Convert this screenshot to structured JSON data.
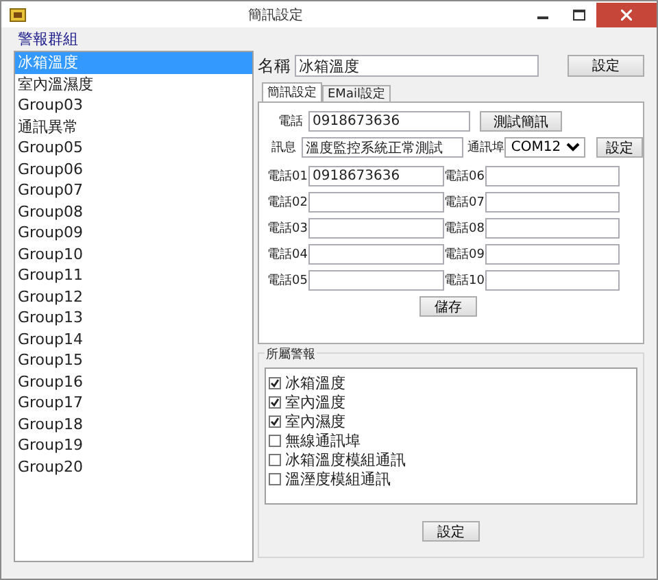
{
  "window": {
    "title": "簡訊設定"
  },
  "groups": {
    "label": "警報群組",
    "items": [
      {
        "text": "冰箱溫度",
        "selected": true
      },
      {
        "text": "室內溫濕度",
        "selected": false
      },
      {
        "text": "Group03",
        "selected": false
      },
      {
        "text": "通訊異常",
        "selected": false
      },
      {
        "text": "Group05",
        "selected": false
      },
      {
        "text": "Group06",
        "selected": false
      },
      {
        "text": "Group07",
        "selected": false
      },
      {
        "text": "Group08",
        "selected": false
      },
      {
        "text": "Group09",
        "selected": false
      },
      {
        "text": "Group10",
        "selected": false
      },
      {
        "text": "Group11",
        "selected": false
      },
      {
        "text": "Group12",
        "selected": false
      },
      {
        "text": "Group13",
        "selected": false
      },
      {
        "text": "Group14",
        "selected": false
      },
      {
        "text": "Group15",
        "selected": false
      },
      {
        "text": "Group16",
        "selected": false
      },
      {
        "text": "Group17",
        "selected": false
      },
      {
        "text": "Group18",
        "selected": false
      },
      {
        "text": "Group19",
        "selected": false
      },
      {
        "text": "Group20",
        "selected": false
      }
    ]
  },
  "name": {
    "label": "名稱",
    "value": "冰箱溫度",
    "button": "設定"
  },
  "tabs": [
    {
      "label": "簡訊設定",
      "selected": true
    },
    {
      "label": "EMail設定",
      "selected": false
    }
  ],
  "sms": {
    "phone": {
      "label": "電話",
      "value": "0918673636",
      "button": "測試簡訊"
    },
    "message": {
      "label": "訊息",
      "value": "溫度監控系統正常測試"
    },
    "port": {
      "label": "通訊埠",
      "value": "COM12",
      "button": "設定"
    },
    "phones": [
      {
        "label": "電話01",
        "value": "0918673636"
      },
      {
        "label": "電話06"
      },
      {
        "label": "電話02"
      },
      {
        "label": "電話07"
      },
      {
        "label": "電話03"
      },
      {
        "label": "電話08"
      },
      {
        "label": "電話04"
      },
      {
        "label": "電話09"
      },
      {
        "label": "電話05"
      },
      {
        "label": "電話10"
      }
    ],
    "save": "儲存"
  },
  "alarms": {
    "label": "所屬警報",
    "items": [
      {
        "text": "冰箱溫度",
        "checked": true
      },
      {
        "text": "室內溫度",
        "checked": true
      },
      {
        "text": "室內濕度",
        "checked": true
      },
      {
        "text": "無線通訊埠",
        "checked": false
      },
      {
        "text": "冰箱溫度模組通訊",
        "checked": false
      },
      {
        "text": "溫溼度模組通訊",
        "checked": false
      }
    ],
    "button": "設定"
  }
}
